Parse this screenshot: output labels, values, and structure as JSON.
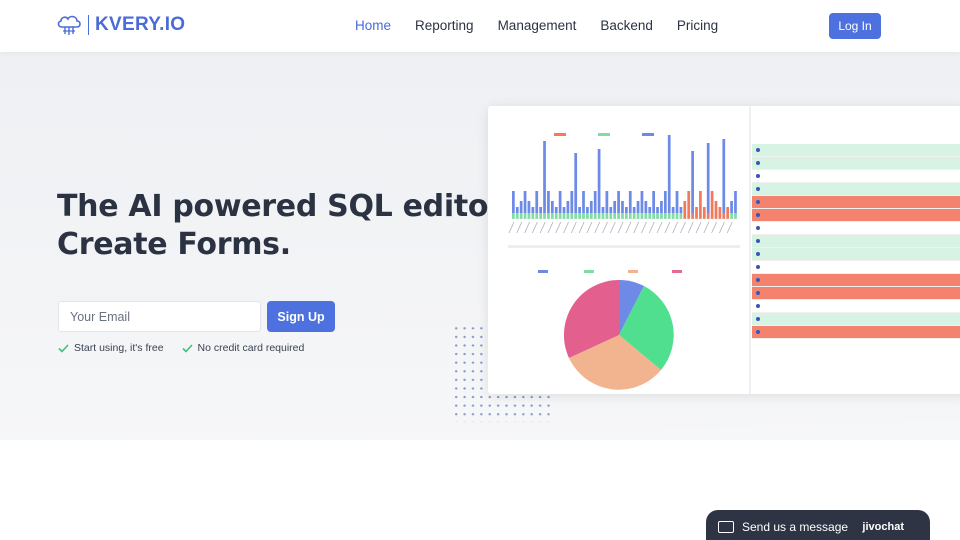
{
  "brand": {
    "name": "KVERY.IO",
    "accent": "#4b6bd6"
  },
  "nav": {
    "items": [
      {
        "label": "Home",
        "active": true
      },
      {
        "label": "Reporting",
        "active": false
      },
      {
        "label": "Management",
        "active": false
      },
      {
        "label": "Backend",
        "active": false
      },
      {
        "label": "Pricing",
        "active": false
      }
    ],
    "login_label": "Log In"
  },
  "hero": {
    "headline_line1": "The AI powered SQL editor.",
    "headline_line2": "Create Forms.",
    "highlight_color": "#b5eccb"
  },
  "signup": {
    "email_placeholder": "Your Email",
    "button_label": "Sign Up",
    "perks": [
      "Start using, it's free",
      "No credit card required"
    ]
  },
  "chat": {
    "label": "Send us a message",
    "brand": "jivochat"
  },
  "colors": {
    "primary_button": "#4d72df",
    "check": "#3fbf7f",
    "chat_bg": "#2e3444"
  }
}
